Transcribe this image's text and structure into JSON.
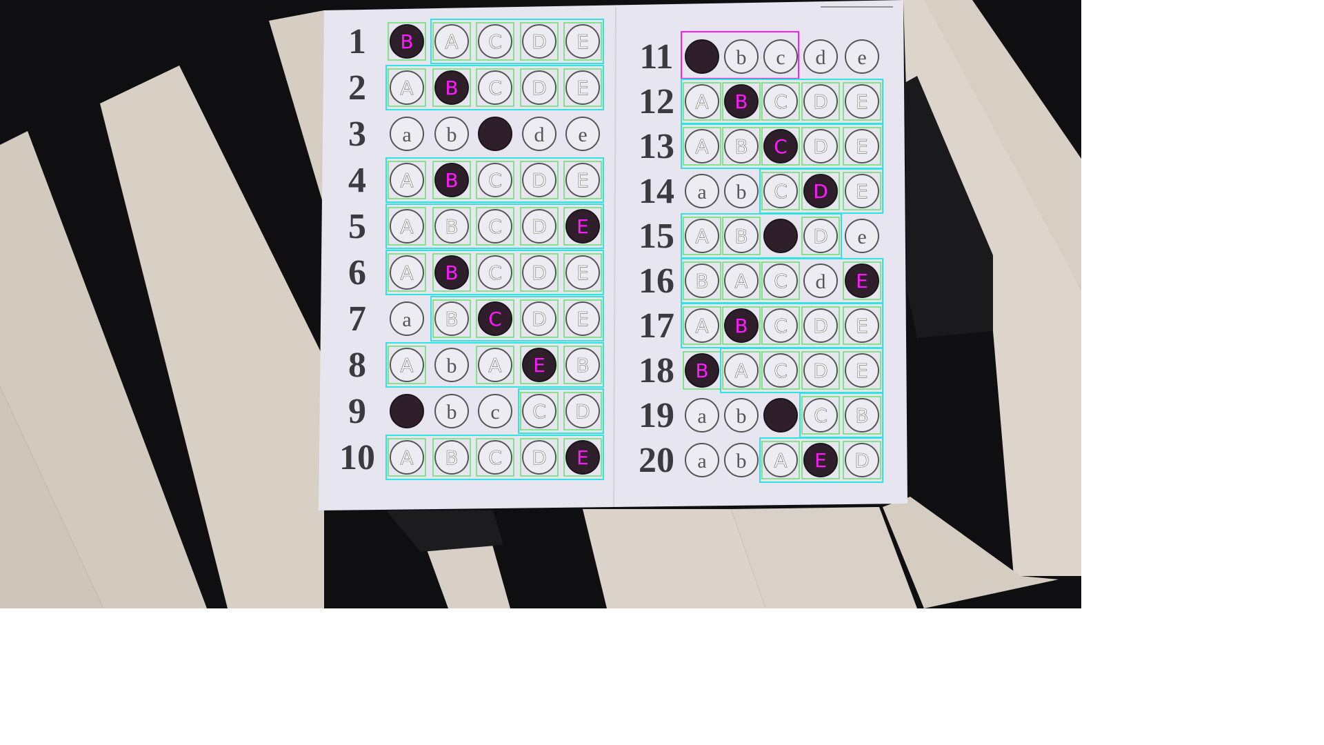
{
  "colors": {
    "background_dark": "#0f0f12",
    "piano_key_white": "#d9d0c6",
    "paper": "#e7e5ef",
    "bubble_outline": "#555555",
    "filled_bubble": "#2e1f2a",
    "detection_cell": "#46e046",
    "detection_group": "#2fe3e3",
    "highlight": "#ff1aff",
    "printed_text": "#3a3a40"
  },
  "questions": [
    {
      "number": "1",
      "printed": [
        "",
        "",
        "",
        "",
        ""
      ],
      "detected": [
        "B",
        "A",
        "C",
        "D",
        "E"
      ],
      "filled": 0,
      "highlight_group": false
    },
    {
      "number": "2",
      "printed": [
        "",
        "",
        "",
        "",
        ""
      ],
      "detected": [
        "A",
        "B",
        "C",
        "D",
        "E"
      ],
      "filled": 1,
      "highlight_group": false
    },
    {
      "number": "3",
      "printed": [
        "a",
        "b",
        "",
        "d",
        "e"
      ],
      "detected": [
        "",
        "",
        "",
        "",
        ""
      ],
      "filled": 2,
      "highlight_group": false
    },
    {
      "number": "4",
      "printed": [
        "",
        "",
        "",
        "",
        ""
      ],
      "detected": [
        "A",
        "B",
        "C",
        "D",
        "E"
      ],
      "filled": 1,
      "highlight_group": false
    },
    {
      "number": "5",
      "printed": [
        "",
        "",
        "",
        "",
        ""
      ],
      "detected": [
        "A",
        "B",
        "C",
        "D",
        "E"
      ],
      "filled": 4,
      "highlight_group": false
    },
    {
      "number": "6",
      "printed": [
        "",
        "",
        "",
        "",
        ""
      ],
      "detected": [
        "A",
        "B",
        "C",
        "D",
        "E"
      ],
      "filled": 1,
      "highlight_group": false
    },
    {
      "number": "7",
      "printed": [
        "a",
        "",
        "",
        "",
        ""
      ],
      "detected": [
        "",
        "B",
        "C",
        "D",
        "E"
      ],
      "filled": 2,
      "highlight_group": false
    },
    {
      "number": "8",
      "printed": [
        "",
        "b",
        "",
        "",
        ""
      ],
      "detected": [
        "A",
        "",
        "A",
        "E",
        "B"
      ],
      "filled": 3,
      "highlight_group": false
    },
    {
      "number": "9",
      "printed": [
        "",
        "b",
        "c",
        "",
        ""
      ],
      "detected": [
        "",
        "",
        "",
        "C",
        "D"
      ],
      "filled": 0,
      "highlight_group": false
    },
    {
      "number": "10",
      "printed": [
        "",
        "",
        "",
        "",
        ""
      ],
      "detected": [
        "A",
        "B",
        "C",
        "D",
        "E"
      ],
      "filled": 4,
      "highlight_group": false
    },
    {
      "number": "11",
      "printed": [
        "",
        "b",
        "c",
        "d",
        "e"
      ],
      "detected": [
        "",
        "",
        "",
        "",
        ""
      ],
      "filled": 0,
      "highlight_group": true
    },
    {
      "number": "12",
      "printed": [
        "",
        "",
        "",
        "",
        ""
      ],
      "detected": [
        "A",
        "B",
        "C",
        "D",
        "E"
      ],
      "filled": 1,
      "highlight_group": false
    },
    {
      "number": "13",
      "printed": [
        "",
        "",
        "",
        "",
        ""
      ],
      "detected": [
        "A",
        "B",
        "C",
        "D",
        "E"
      ],
      "filled": 2,
      "highlight_group": false
    },
    {
      "number": "14",
      "printed": [
        "a",
        "b",
        "",
        "",
        ""
      ],
      "detected": [
        "",
        "",
        "C",
        "D",
        "E"
      ],
      "filled": 3,
      "highlight_group": false
    },
    {
      "number": "15",
      "printed": [
        "",
        "",
        "",
        "",
        "e"
      ],
      "detected": [
        "A",
        "B",
        "",
        "D",
        ""
      ],
      "filled": 2,
      "highlight_group": false
    },
    {
      "number": "16",
      "printed": [
        "",
        "",
        "",
        "d",
        ""
      ],
      "detected": [
        "B",
        "A",
        "C",
        "",
        "E"
      ],
      "filled": 4,
      "highlight_group": false
    },
    {
      "number": "17",
      "printed": [
        "",
        "",
        "",
        "",
        ""
      ],
      "detected": [
        "A",
        "B",
        "C",
        "D",
        "E"
      ],
      "filled": 1,
      "highlight_group": false
    },
    {
      "number": "18",
      "printed": [
        "",
        "",
        "",
        "",
        ""
      ],
      "detected": [
        "B",
        "A",
        "C",
        "D",
        "E"
      ],
      "filled": 0,
      "highlight_group": false
    },
    {
      "number": "19",
      "printed": [
        "a",
        "b",
        "",
        "",
        ""
      ],
      "detected": [
        "",
        "",
        "",
        "C",
        "B"
      ],
      "filled": 2,
      "highlight_group": false
    },
    {
      "number": "20",
      "printed": [
        "a",
        "b",
        "",
        "",
        ""
      ],
      "detected": [
        "",
        "",
        "A",
        "E",
        "D"
      ],
      "filled": 3,
      "highlight_group": false
    }
  ]
}
